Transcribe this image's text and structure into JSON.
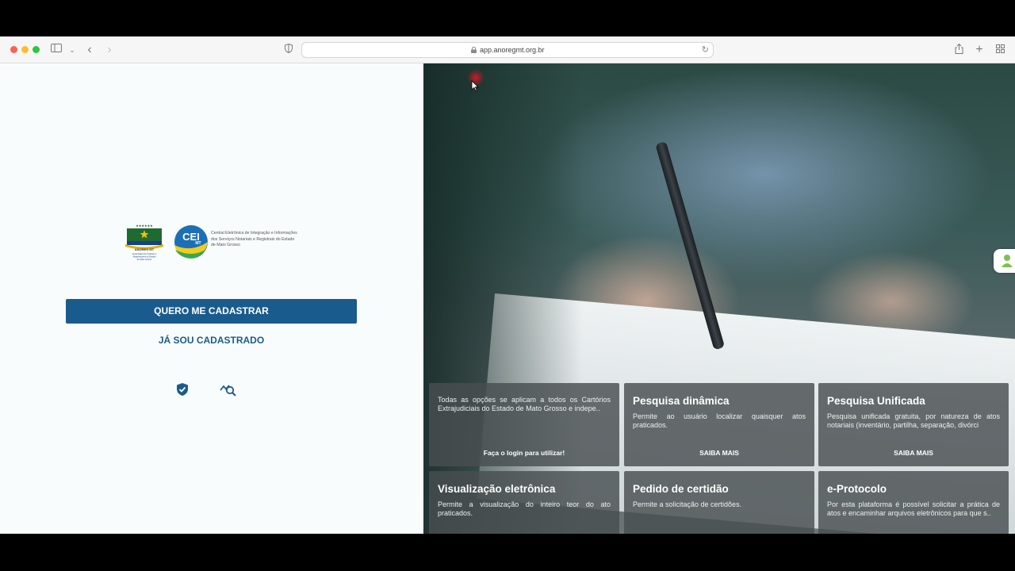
{
  "browser": {
    "url": "app.anoregmt.org.br"
  },
  "logos": {
    "anoreg_text": "ANOREG MT",
    "anoreg_caption": "Associação dos Notários e Registradores do Estado de Mato Grosso",
    "cei_text": "CEI",
    "cei_sub": "MT",
    "cei_caption": "Central Eletrônica de Integração e Informações dos Serviços Notariais e Registrais do Estado de Mato Grosso"
  },
  "auth": {
    "register_label": "QUERO ME CADASTRAR",
    "login_label": "JÁ SOU CADASTRADO"
  },
  "icons": {
    "privacy": "shield-check-icon",
    "search_chart": "chart-search-icon"
  },
  "cards": [
    {
      "title": "",
      "description": "Todas as opções se aplicam a todos os Cartórios Extrajudiciais do Estado de Mato Grosso e indepe..",
      "action": "Faça o login para utilizar!"
    },
    {
      "title": "Pesquisa dinâmica",
      "description": "Permite ao usuário localizar quaisquer atos praticados.",
      "action": "SAIBA MAIS"
    },
    {
      "title": "Pesquisa Unificada",
      "description": "Pesquisa unificada gratuita, por natureza de atos notariais (inventário, partilha, separação, divórci",
      "action": "SAIBA MAIS"
    },
    {
      "title": "Visualização eletrônica",
      "description": "Permite a visualização do inteiro teor do ato praticados."
    },
    {
      "title": "Pedido de certidão",
      "description": "Permite a solicitação de certidões."
    },
    {
      "title": "e-Protocolo",
      "description": "Por esta plataforma é possível solicitar a prática de atos e encaminhar arquivos eletrônicos para que s.."
    }
  ],
  "colors": {
    "brand_blue": "#1a5b8e",
    "card_bg": "#484e50"
  }
}
